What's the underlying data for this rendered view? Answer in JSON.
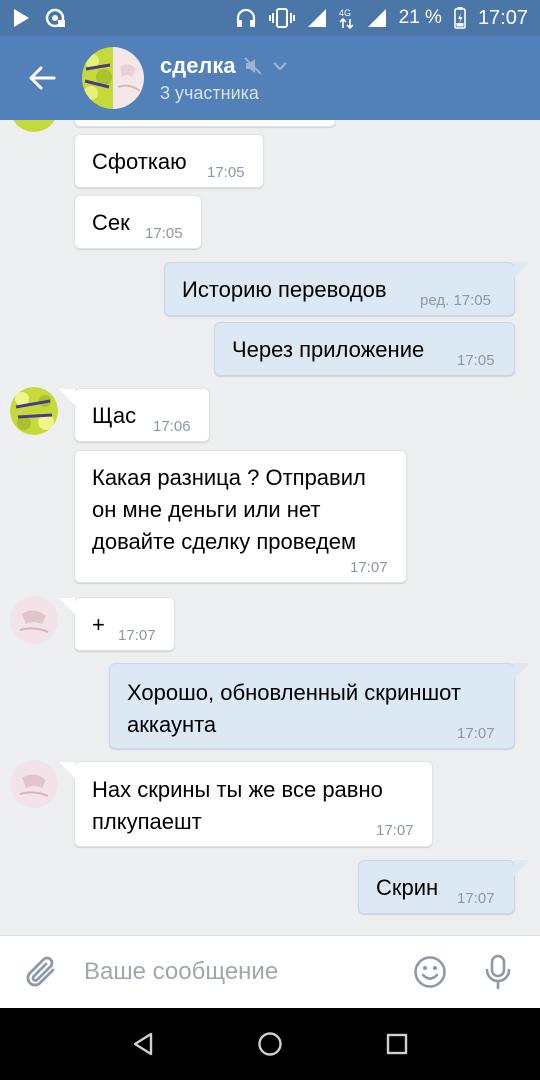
{
  "status_bar": {
    "battery": "21 %",
    "time": "17:07"
  },
  "header": {
    "title": "сделка",
    "subtitle": "3 участника"
  },
  "messages": [
    {
      "text": "Сфоткаю",
      "time": "17:05"
    },
    {
      "text": "Сек",
      "time": "17:05"
    },
    {
      "text": "Историю переводов",
      "time": "ред. 17:05"
    },
    {
      "text": "Через приложение",
      "time": "17:05"
    },
    {
      "text": "Щас",
      "time": "17:06"
    },
    {
      "lines": [
        "Какая разница ? Отправил",
        "он мне деньги или нет",
        "довайте сделку проведем"
      ],
      "time": "17:07"
    },
    {
      "text": "+",
      "time": "17:07"
    },
    {
      "lines": [
        "Хорошо, обновленный скриншот",
        "аккаунта"
      ],
      "time": "17:07"
    },
    {
      "lines": [
        "Нах скрины ты же все равно",
        "плкупаешт"
      ],
      "time": "17:07"
    },
    {
      "text": "Скрин",
      "time": "17:07"
    }
  ],
  "composer": {
    "placeholder": "Ваше сообщение"
  },
  "colors": {
    "header": "#5181b8",
    "status_bar": "#4a76a8",
    "incoming": "#ffffff",
    "outgoing": "#dde8f5",
    "background": "#edeef0"
  },
  "icons": [
    "play-icon",
    "cast-icon",
    "headphones-icon",
    "vibrate-icon",
    "signal-icon",
    "4g-icon",
    "battery-icon",
    "back-arrow-icon",
    "mute-icon",
    "chevron-down-icon",
    "paperclip-icon",
    "smiley-icon",
    "microphone-icon",
    "nav-back-icon",
    "nav-home-icon",
    "nav-recents-icon"
  ]
}
